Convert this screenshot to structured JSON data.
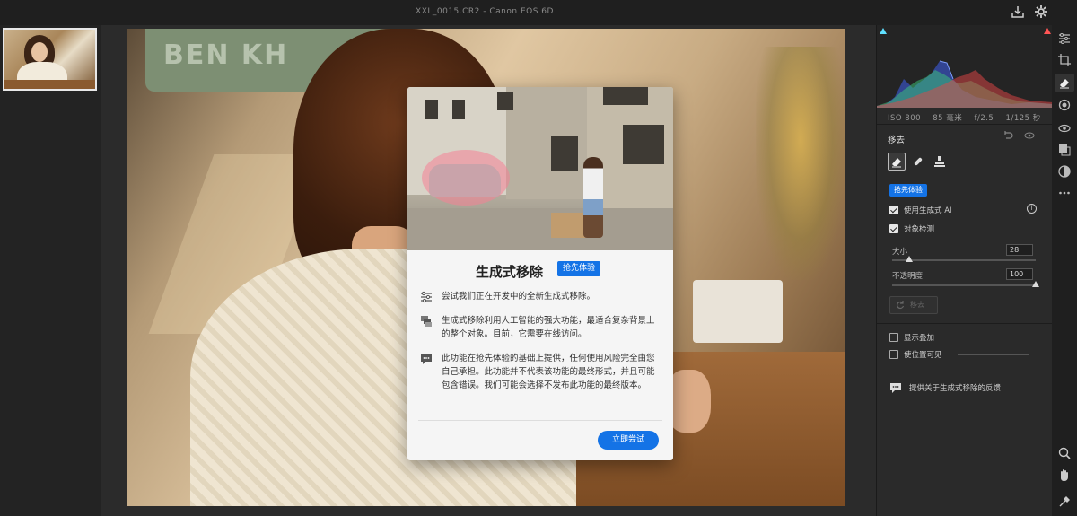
{
  "titlebar": {
    "title": "XXL_0015.CR2 - Canon EOS 6D"
  },
  "photo": {
    "sign_text": "BEN KH"
  },
  "modal": {
    "title": "生成式移除",
    "badge": "抢先体验",
    "items": [
      {
        "icon": "sliders-icon",
        "text": "尝试我们正在开发中的全新生成式移除。"
      },
      {
        "icon": "layers-icon",
        "text": "生成式移除利用人工智能的强大功能，最适合复杂背景上的整个对象。目前，它需要在线访问。"
      },
      {
        "icon": "chat-icon",
        "text": "此功能在抢先体验的基础上提供，任何使用风险完全由您自己承担。此功能并不代表该功能的最终形式，并且可能包含错误。我们可能会选择不发布此功能的最终版本。"
      }
    ],
    "cta": "立即尝试"
  },
  "panel": {
    "exif": {
      "iso": "ISO 800",
      "focal": "85 毫米",
      "aperture": "f/2.5",
      "shutter": "1/125 秒"
    },
    "section_title": "移去",
    "ai_badge": "抢先体验",
    "options": [
      {
        "label": "使用生成式 AI",
        "checked": true
      },
      {
        "label": "对象检测",
        "checked": true
      }
    ],
    "size": {
      "label": "大小",
      "value": "28",
      "fraction": 0.12
    },
    "opacity": {
      "label": "不透明度",
      "value": "100",
      "fraction": 1.0
    },
    "remove_button": "移去",
    "show_overlay": {
      "label": "显示叠加",
      "checked": false
    },
    "reset_position": {
      "label": "使位置可见",
      "checked": false
    },
    "feedback": "提供关于生成式移除的反馈"
  },
  "colors": {
    "accent": "#1473e6",
    "panel_bg": "#2a2a2a",
    "canvas_bg": "#2b2b2b"
  }
}
